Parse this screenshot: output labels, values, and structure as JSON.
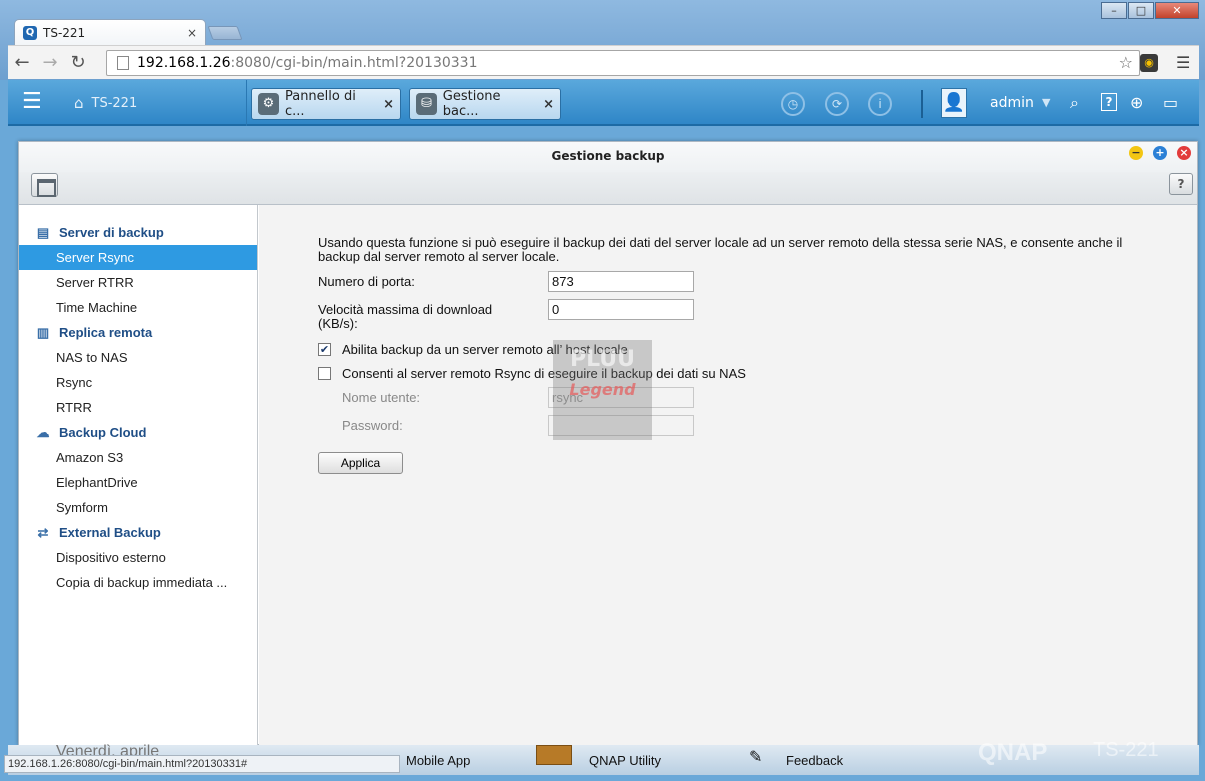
{
  "browser": {
    "tab_title": "TS-221",
    "tab_close": "×",
    "address": {
      "host": "192.168.1.26",
      "rest": ":8080/cgi-bin/main.html?20130331"
    },
    "status_url": "192.168.1.26:8080/cgi-bin/main.html?20130331#"
  },
  "qnap": {
    "home_label": "TS-221",
    "app_tabs": [
      {
        "label": "Pannello di c...",
        "close": "×"
      },
      {
        "label": "Gestione bac...",
        "close": "×"
      }
    ],
    "user": "admin",
    "icons": [
      "clock-icon",
      "sync-icon",
      "info-icon",
      "search-icon",
      "help-icon",
      "globe-icon",
      "monitor-icon"
    ]
  },
  "window": {
    "title": "Gestione backup",
    "help": "?"
  },
  "sidebar": {
    "sections": [
      {
        "label": "Server di backup",
        "icon": "server-icon",
        "items": [
          "Server Rsync",
          "Server RTRR",
          "Time Machine"
        ]
      },
      {
        "label": "Replica remota",
        "icon": "replica-icon",
        "items": [
          "NAS to NAS",
          "Rsync",
          "RTRR"
        ]
      },
      {
        "label": "Backup Cloud",
        "icon": "cloud-icon",
        "items": [
          "Amazon S3",
          "ElephantDrive",
          "Symform"
        ]
      },
      {
        "label": "External Backup",
        "icon": "external-backup-icon",
        "items": [
          "Dispositivo esterno",
          "Copia di backup immediata ..."
        ]
      }
    ],
    "active": "Server Rsync"
  },
  "form": {
    "description": "Usando questa funzione si può eseguire il backup dei dati del server locale ad un server remoto della stessa serie NAS, e consente anche il backup dal server remoto al server locale.",
    "port_label": "Numero di porta:",
    "port_value": "873",
    "speed_label": "Velocità massima di download (KB/s):",
    "speed_value": "0",
    "cb1_label": "Abilita backup da un server remoto all’ host locale",
    "cb1_checked": true,
    "cb2_label": "Consenti al server remoto Rsync di eseguire il backup dei dati su NAS",
    "cb2_checked": false,
    "user_label": "Nome utente:",
    "user_value": "rsync",
    "pass_label": "Password:",
    "pass_value": "",
    "apply": "Applica"
  },
  "watermark": {
    "top": "PLUU",
    "bottom": "Legend"
  },
  "taskbar": {
    "left_text": "Venerdì, aprile",
    "items": [
      "Mobile App",
      "QNAP Utility",
      "Feedback"
    ],
    "brand": "QNAP",
    "model": "TS-221"
  }
}
